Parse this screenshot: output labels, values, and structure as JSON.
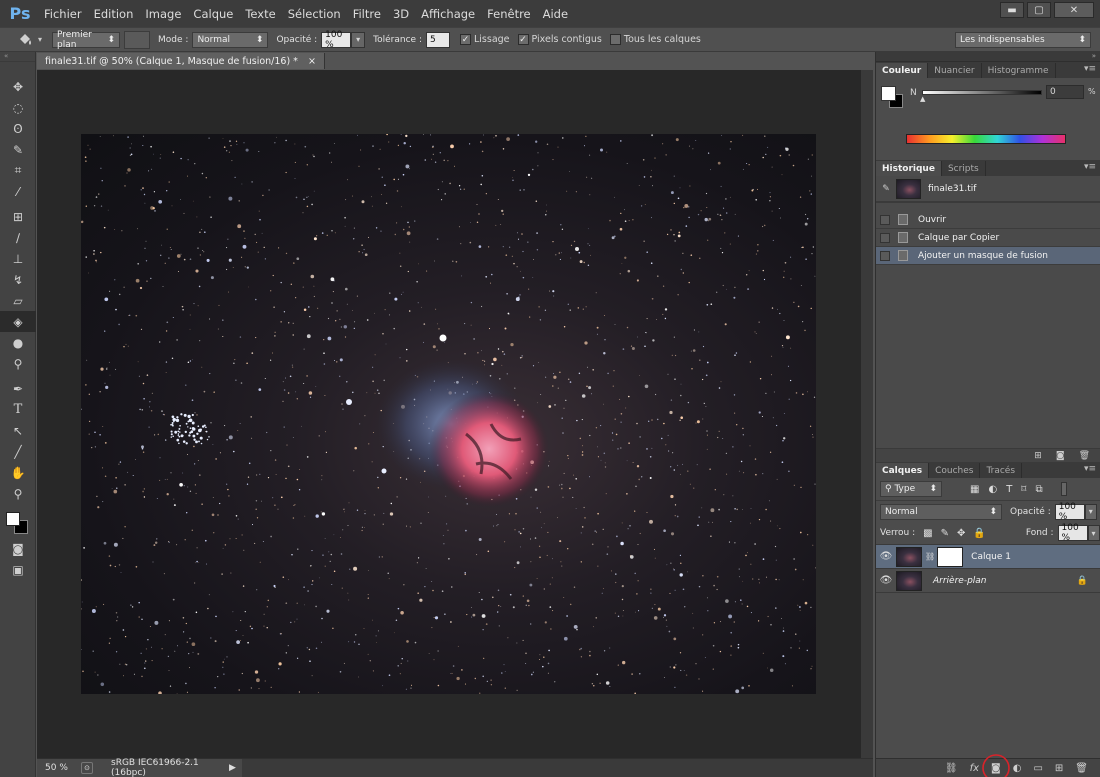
{
  "app": {
    "logo": "Ps"
  },
  "menu": [
    "Fichier",
    "Edition",
    "Image",
    "Calque",
    "Texte",
    "Sélection",
    "Filtre",
    "3D",
    "Affichage",
    "Fenêtre",
    "Aide"
  ],
  "window_controls": {
    "minimize": "▬",
    "maximize": "▢",
    "close": "✕"
  },
  "options": {
    "tool_icon": "paint-bucket-icon",
    "fill_source": "Premier plan",
    "mode_label": "Mode :",
    "mode_value": "Normal",
    "opacity_label": "Opacité :",
    "opacity_value": "100 %",
    "tolerance_label": "Tolérance :",
    "tolerance_value": "5",
    "lissage_label": "Lissage",
    "contigus_label": "Pixels contigus",
    "tous_calques_label": "Tous les calques",
    "workspace": "Les indispensables"
  },
  "document": {
    "tab_title": "finale31.tif @ 50% (Calque 1, Masque de fusion/16) *",
    "close": "×",
    "zoom": "50 %",
    "profile": "sRGB IEC61966-2.1 (16bpc)"
  },
  "color_panel": {
    "tabs": [
      "Couleur",
      "Nuancier",
      "Histogramme"
    ],
    "channel_label": "N",
    "value": "0",
    "unit": "%"
  },
  "history_panel": {
    "tabs": [
      "Historique",
      "Scripts"
    ],
    "snapshot": "finale31.tif",
    "steps": [
      "Ouvrir",
      "Calque par Copier",
      "Ajouter un masque de fusion"
    ],
    "selected_step": 2
  },
  "layers_panel": {
    "tabs": [
      "Calques",
      "Couches",
      "Tracés"
    ],
    "filter": "Type",
    "blend_mode": "Normal",
    "opacity_label": "Opacité :",
    "opacity_value": "100 %",
    "lock_label": "Verrou :",
    "fill_label": "Fond :",
    "fill_value": "100 %",
    "layers": [
      {
        "name": "Calque 1",
        "selected": true,
        "has_mask": true
      },
      {
        "name": "Arrière-plan",
        "selected": false,
        "locked": true
      }
    ]
  },
  "colors": {
    "accent_selection": "#5f6d80",
    "highlight_circle": "#d8232a",
    "nebula_pink": "#e8607a",
    "nebula_blue": "#7f95c8"
  }
}
